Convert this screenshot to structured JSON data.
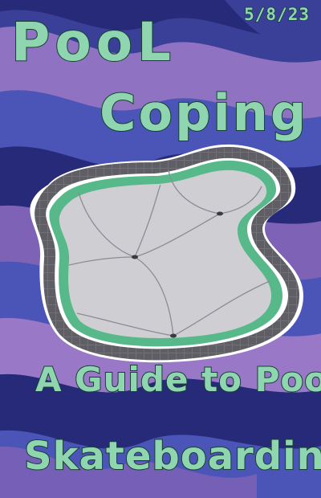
{
  "cover": {
    "date": "5/8/23",
    "title_line1": "PooL",
    "title_line2": "Coping",
    "subtitle_line1": "A Guide to PooL",
    "subtitle_line2": "Skateboarding"
  },
  "colors": {
    "lettering": "#8fd6b0",
    "lettering_outline": "#14402e",
    "background_wave_lavender": "#9a78c8",
    "background_wave_blue": "#4b55b8",
    "background_wave_navy": "#262a78",
    "pool_floor": "#cfcfd3",
    "pool_coping": "#6a6a70",
    "pool_wall": "#57b98a"
  },
  "icons": [
    "empty-pool-illustration"
  ]
}
